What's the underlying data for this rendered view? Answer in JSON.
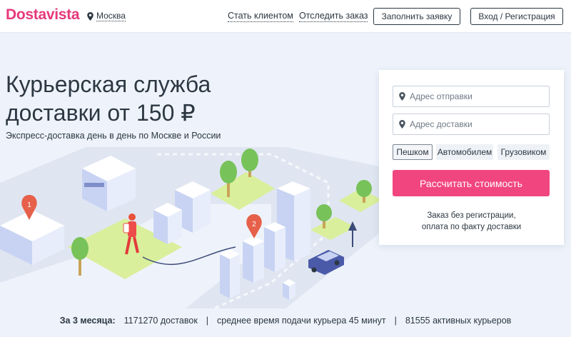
{
  "header": {
    "logo": "Dostavista",
    "city": "Москва",
    "nav": [
      "Стать клиентом",
      "Отследить заказ"
    ],
    "fill_request": "Заполнить заявку",
    "login": "Вход / Регистрация"
  },
  "hero": {
    "title_line1": "Курьерская служба",
    "title_line2": "доставки от 150 ₽",
    "subtitle": "Экспресс-доставка день в день по Москве и России"
  },
  "form": {
    "pickup_placeholder": "Адрес отправки",
    "delivery_placeholder": "Адрес доставки",
    "modes": [
      "Пешком",
      "Автомобилем",
      "Грузовиком"
    ],
    "active_mode": "Пешком",
    "calculate": "Рассчитать стоимость",
    "note_line1": "Заказ без регистрации,",
    "note_line2": "оплата по факту доставки"
  },
  "illustration": {
    "marker_1": "1",
    "marker_2": "2"
  },
  "stats": {
    "label": "За 3 месяца:",
    "deliveries": "1171270 доставок",
    "avg_time": "среднее время подачи курьера 45 минут",
    "couriers": "81555 активных курьеров",
    "separator": "|"
  },
  "colors": {
    "brand": "#e6397a",
    "button": "#f1457f",
    "background": "#eef3fb"
  }
}
